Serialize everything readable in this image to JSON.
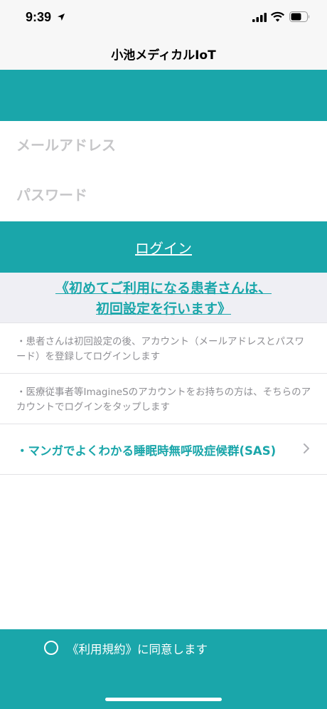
{
  "status_bar": {
    "time": "9:39",
    "icons": [
      "location-arrow-icon",
      "cellular-signal-icon",
      "wifi-icon",
      "battery-icon"
    ]
  },
  "nav": {
    "title": "小池メディカルIoT"
  },
  "form": {
    "email_placeholder": "メールアドレス",
    "email_value": "",
    "password_placeholder": "パスワード",
    "password_value": ""
  },
  "login": {
    "label": "ログイン"
  },
  "first_time": {
    "line1": "《初めてご利用になる患者さんは、",
    "line2": "初回設定を行います》"
  },
  "info": {
    "patient_note": "・患者さんは初回設定の後、アカウント（メールアドレスとパスワード）を登録してログインします",
    "staff_note": "・医療従事者等ImagineSのアカウントをお持ちの方は、そちらのアカウントでログインをタップします"
  },
  "manga": {
    "label": "・マンガでよくわかる睡眠時無呼吸症候群(SAS)",
    "icon": "chevron-right-icon"
  },
  "footer": {
    "agree_label": "《利用規約》に同意します",
    "agree_checked": false
  },
  "colors": {
    "accent": "#1aa6aa",
    "background": "#ffffff",
    "secondary_background": "#efeff4",
    "muted_text": "#8e8e93"
  }
}
